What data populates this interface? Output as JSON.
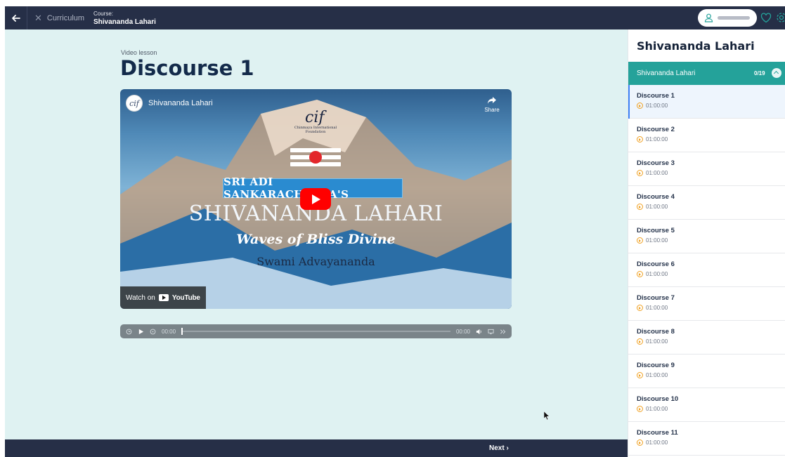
{
  "topbar": {
    "curriculum_label": "Curriculum",
    "course_label": "Course:",
    "course_title": "Shivananda Lahari",
    "icons": [
      "back-arrow-icon",
      "close-icon",
      "user-icon",
      "heart-icon",
      "gear-icon"
    ]
  },
  "lesson": {
    "type_label": "Video lesson",
    "title": "Discourse 1"
  },
  "video": {
    "channel_title": "Shivananda Lahari",
    "share_label": "Share",
    "logo_text": "cif",
    "foundation_text": "Chinmaya International Foundation",
    "banner_text": "SRI ADI SANKARACHARYA'S",
    "main_title": "SHIVANANDA LAHARI",
    "subtitle": "Waves of Bliss Divine",
    "author": "Swami Advayananda",
    "watch_on": "Watch on",
    "youtube": "YouTube"
  },
  "player": {
    "current_time": "00:00",
    "total_time": "00:00",
    "progress": 0
  },
  "footer": {
    "next_label": "Next ›"
  },
  "sidebar": {
    "title": "Shivananda Lahari",
    "section_name": "Shivananda Lahari",
    "section_count": "0/19",
    "accent": "#24a29a",
    "items": [
      {
        "name": "Discourse 1",
        "duration": "01:00:00"
      },
      {
        "name": "Discourse 2",
        "duration": "01:00:00"
      },
      {
        "name": "Discourse 3",
        "duration": "01:00:00"
      },
      {
        "name": "Discourse 4",
        "duration": "01:00:00"
      },
      {
        "name": "Discourse 5",
        "duration": "01:00:00"
      },
      {
        "name": "Discourse 6",
        "duration": "01:00:00"
      },
      {
        "name": "Discourse 7",
        "duration": "01:00:00"
      },
      {
        "name": "Discourse 8",
        "duration": "01:00:00"
      },
      {
        "name": "Discourse 9",
        "duration": "01:00:00"
      },
      {
        "name": "Discourse 10",
        "duration": "01:00:00"
      },
      {
        "name": "Discourse 11",
        "duration": "01:00:00"
      }
    ]
  }
}
